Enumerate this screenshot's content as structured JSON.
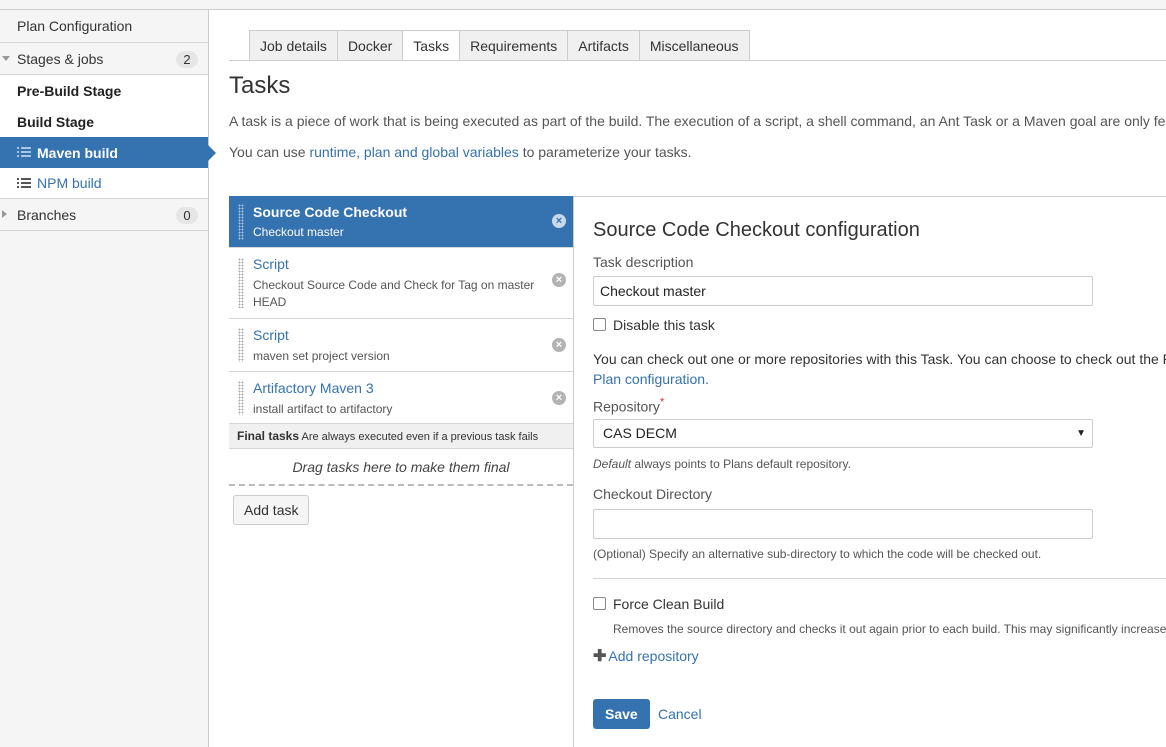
{
  "sidebar": {
    "plan_configuration": "Plan Configuration",
    "stages_jobs": "Stages & jobs",
    "stages_jobs_count": "2",
    "pre_build_stage": "Pre-Build Stage",
    "build_stage": "Build Stage",
    "maven_build": "Maven build",
    "npm_build": "NPM build",
    "branches": "Branches",
    "branches_count": "0"
  },
  "tabs": [
    "Job details",
    "Docker",
    "Tasks",
    "Requirements",
    "Artifacts",
    "Miscellaneous"
  ],
  "active_tab": "Tasks",
  "page": {
    "title": "Tasks",
    "intro": "A task is a piece of work that is being executed as part of the build. The execution of a script, a shell command, an Ant Task or a Maven goal are only fe",
    "vars_prefix": "You can use ",
    "vars_link": "runtime, plan and global variables",
    "vars_suffix": " to parameterize your tasks."
  },
  "tasks": [
    {
      "title": "Source Code Checkout",
      "desc": "Checkout master"
    },
    {
      "title": "Script",
      "desc": "Checkout Source Code and Check for Tag on master HEAD"
    },
    {
      "title": "Script",
      "desc": "maven set project version"
    },
    {
      "title": "Artifactory Maven 3",
      "desc": "install artifact to artifactory"
    }
  ],
  "final_tasks": {
    "label": "Final tasks",
    "note": "Are always executed even if a previous task fails",
    "drop_hint": "Drag tasks here to make them final"
  },
  "add_task": "Add task",
  "config": {
    "title": "Source Code Checkout configuration",
    "task_description_label": "Task description",
    "task_description_value": "Checkout master",
    "disable_label": "Disable this task",
    "info_line": "You can check out one or more repositories with this Task. You can choose to check out the P",
    "info_link": "Plan configuration.",
    "repository_label": "Repository",
    "required_mark": "*",
    "repository_value": "CAS DECM",
    "repository_help_em": "Default",
    "repository_help": " always points to Plans default repository.",
    "checkout_dir_label": "Checkout Directory",
    "checkout_dir_value": "",
    "checkout_dir_help": "(Optional) Specify an alternative sub-directory to which the code will be checked out.",
    "force_clean_label": "Force Clean Build",
    "force_clean_help": "Removes the source directory and checks it out again prior to each build. This may significantly increase",
    "add_repository": "Add repository",
    "save": "Save",
    "cancel": "Cancel"
  }
}
